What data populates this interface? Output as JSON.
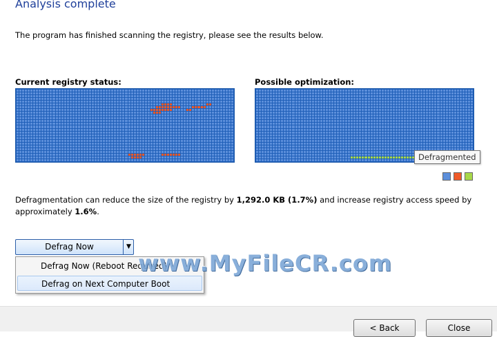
{
  "header": {
    "title": "Analysis complete"
  },
  "description": "The program has finished scanning the registry, please see the results below.",
  "panels": {
    "current_label": "Current registry status:",
    "possible_label": "Possible optimization:"
  },
  "tooltip": "Defragmented",
  "legend": {
    "colors": [
      "#5c8fdb",
      "#f05a28",
      "#a8d84a"
    ],
    "icons": [
      "legend-normal-icon",
      "legend-fragmented-icon",
      "legend-defragmented-icon"
    ]
  },
  "info": {
    "part1": "Defragmentation can reduce the size of the registry by ",
    "size": "1,292.0 KB (1.7%)",
    "part2": " and increase registry access speed by approximately ",
    "speed": "1.6%",
    "part3": "."
  },
  "defrag_button": {
    "label": "Defrag Now",
    "arrow_icon": "dropdown-arrow-icon"
  },
  "menu": {
    "items": [
      {
        "label": "Defrag Now (Reboot Required)"
      },
      {
        "label": "Defrag on Next Computer Boot"
      }
    ]
  },
  "watermark": "www.MyFileCR.com",
  "footer": {
    "back": "< Back",
    "close": "Close"
  },
  "colors": {
    "accent": "#1e3f9a",
    "grid_bg": "#1f5fb8",
    "fragmented": "#f05a28",
    "defragmented": "#a8d84a"
  }
}
